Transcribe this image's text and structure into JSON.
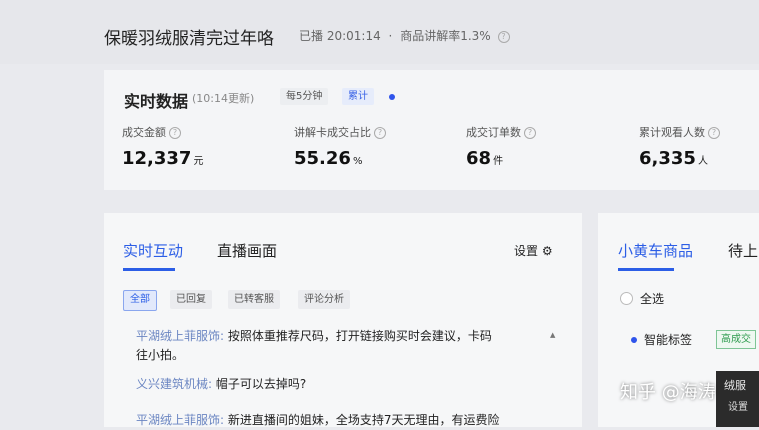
{
  "header": {
    "title": "保暖羽绒服清完过年咯",
    "live_label": "已播 20:01:14",
    "rate_label": "商品讲解率1.3%"
  },
  "realtime": {
    "title": "实时数据",
    "update": "(10:14更新)",
    "chip_every": "每5分钟",
    "chip_cumulative": "累计",
    "metrics": [
      {
        "label": "成交金额",
        "value": "12,337",
        "unit": "元"
      },
      {
        "label": "讲解卡成交占比",
        "value": "55.26",
        "unit": "%"
      },
      {
        "label": "成交订单数",
        "value": "68",
        "unit": "件"
      },
      {
        "label": "累计观看人数",
        "value": "6,335",
        "unit": "人"
      }
    ]
  },
  "interaction": {
    "tabs": [
      "实时互动",
      "直播画面"
    ],
    "settings": "设置",
    "filters": [
      "全部",
      "已回复",
      "已转客服",
      "评论分析"
    ],
    "messages": [
      {
        "user": "平湖绒上菲服饰:",
        "text": "按照体重推荐尺码，打开链接购买时会建议，卡码",
        "text2": "往小拍。"
      },
      {
        "user": "义兴建筑机械:",
        "text": "帽子可以去掉吗?"
      },
      {
        "user": "平湖绒上菲服饰:",
        "text": "新进直播间的姐妹，全场支持7天无理由，有运费险"
      }
    ]
  },
  "products": {
    "tabs": [
      "小黄车商品",
      "待上"
    ],
    "select_all": "全选",
    "smart_label": "智能标签",
    "badge": "高成交",
    "product_title": "绒服",
    "product_small": "设置"
  },
  "watermark": "知乎 @海涛",
  "colors": {
    "accent": "#2c5ee6",
    "badge_green": "#2e9b4e"
  }
}
